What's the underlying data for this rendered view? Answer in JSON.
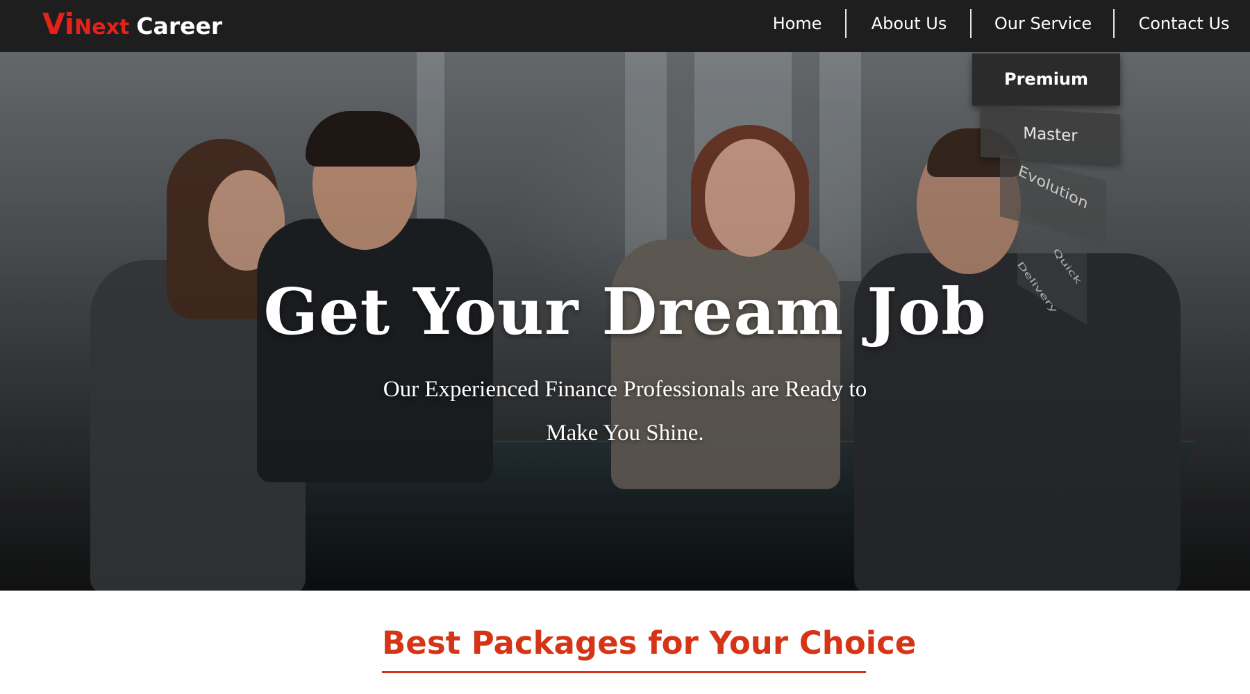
{
  "brand": {
    "vi": "Vi",
    "next": "Next",
    "career": "Career",
    "accent_color": "#e32219"
  },
  "nav": {
    "items": [
      {
        "label": "Home"
      },
      {
        "label": "About Us"
      },
      {
        "label": "Our Service"
      },
      {
        "label": "Contact Us"
      }
    ]
  },
  "service_dropdown": {
    "items": [
      {
        "label": "Premium"
      },
      {
        "label": "Master"
      },
      {
        "label": "Evolution"
      },
      {
        "label": "Quick Delivery"
      }
    ]
  },
  "hero": {
    "title": "Get Your Dream Job",
    "subtitle_line1": "Our Experienced Finance Professionals are Ready to",
    "subtitle_line2": "Make You Shine."
  },
  "packages": {
    "title": "Best Packages for Your Choice",
    "accent_color": "#d63416"
  }
}
